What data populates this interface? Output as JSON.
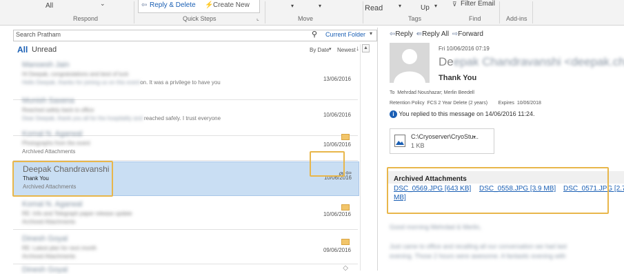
{
  "ribbon": {
    "all_label": "All",
    "respond_group": "Respond",
    "reply_delete": "Reply & Delete",
    "create_new": "Create New",
    "quick_steps_group": "Quick Steps",
    "move_group": "Move",
    "read_label": "Read",
    "up_label": "Up",
    "filter_email": "Filter Email",
    "tags_group": "Tags",
    "find_group": "Find",
    "addins_group": "Add-ins"
  },
  "search": {
    "placeholder": "Search Pratham",
    "scope": "Current Folder"
  },
  "list_header": {
    "tab_all": "All",
    "tab_unread": "Unread",
    "sort_by": "By Date",
    "order": "Newest"
  },
  "messages": [
    {
      "from": "Manoesh Jain",
      "subject": "Hi Deepak, congratulations and best of luck",
      "preview_hidden": "Hello Deepak, thanks for joining us on this event",
      "preview_visible": "on. It was a privilege to have you",
      "date": "13/06/2016"
    },
    {
      "from": "Munish Saxena",
      "subject": "Reached safely back to office",
      "preview_hidden": "Dear Deepak, thank you all for the hospitality and",
      "preview_visible": "reached safely. I trust everyone",
      "date": "10/06/2016"
    },
    {
      "from": "Komal N. Agarwal",
      "subject": "Photographs from the event",
      "preview_visible": "Archived Attachments",
      "date": "10/06/2016"
    },
    {
      "from": "Deepak Chandravanshi",
      "subject": "Thank You",
      "preview_visible": "Archived Attachments",
      "date": "10/06/2016"
    },
    {
      "from": "Komal N. Agarwal",
      "subject": "RE: Info and Telegraph paper release update",
      "preview_hidden": "Archived Attachments",
      "date": "10/06/2016"
    },
    {
      "from": "Dinesh Goyal",
      "subject": "RE: Latest plan for next month",
      "preview_hidden": "Archived Attachments",
      "date": "09/06/2016"
    },
    {
      "from": "Dinesh Goyal",
      "subject": "",
      "date": ""
    }
  ],
  "reading_pane": {
    "reply": "Reply",
    "reply_all": "Reply All",
    "forward": "Forward",
    "sent_date": "Fri 10/06/2016 07:19",
    "sender_visible": "De",
    "sender_rest": "epak Chandravanshi <deepak.cha",
    "subject": "Thank You",
    "to_label": "To",
    "to_value": "Mehrdad Noushazar; Merlin Beedell",
    "retention_label": "Retention Policy",
    "retention_value": "FCS 2 Year Delete (2 years)",
    "expires_label": "Expires",
    "expires_value": "10/06/2018",
    "info_text": "You replied to this message on 14/06/2016 11:24.",
    "attachment_name": "C:\\Cryoserver\\CryoStu...",
    "attachment_size": "1 KB",
    "archived_title": "Archived Attachments",
    "links": [
      "DSC_0569.JPG [643 KB]",
      "DSC_0558.JPG [3.9 MB]",
      "DSC_0571.JPG [2.7"
    ],
    "links_wrap": "MB]",
    "body_line1": "Good morning Mehrdad & Merlin,",
    "body_line2": "Just came to office and recalling all our conversation we had last",
    "body_line3": "evening. Those 2 hours were awesome. A fantastic evening with"
  },
  "colors": {
    "highlight_border": "#e8b64a",
    "selected_row": "#c9def3",
    "link": "#1a5fb4",
    "accent_blue": "#1a5fb4"
  }
}
